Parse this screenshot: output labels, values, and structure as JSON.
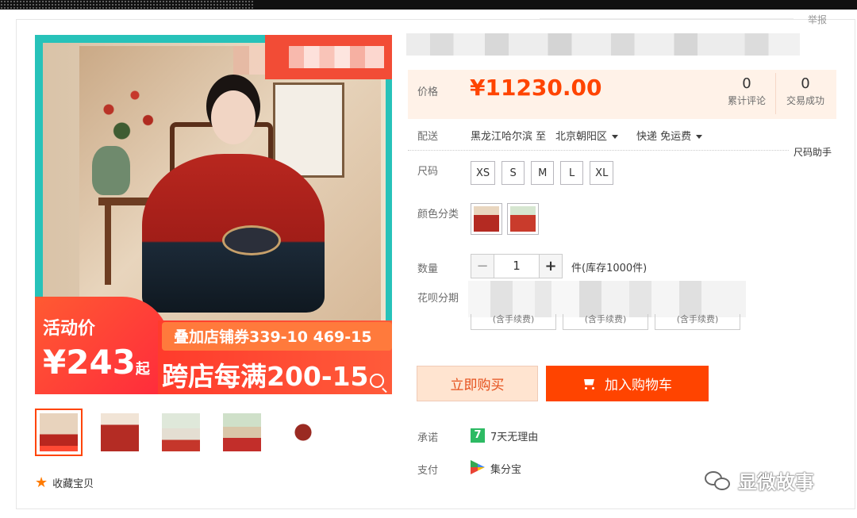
{
  "report_label": "举报",
  "gallery": {
    "promo_label": "活动价",
    "promo_price": "¥243",
    "promo_price_suffix": "起",
    "promo_line1": "叠加店铺券339-10 469-15",
    "promo_line2": "跨店每满200-15",
    "thumbnails": [
      "thumb-1",
      "thumb-2",
      "thumb-3",
      "thumb-4",
      "thumb-5"
    ],
    "active_thumb": 0,
    "favorite_label": "收藏宝贝"
  },
  "price_section": {
    "label": "价格",
    "price": "¥11230.00",
    "reviews_count": "0",
    "reviews_label": "累计评论",
    "deals_count": "0",
    "deals_label": "交易成功"
  },
  "shipping": {
    "label": "配送",
    "from_to": "黑龙江哈尔滨 至",
    "destination": "北京朝阳区",
    "method": "快递 免运费"
  },
  "size": {
    "label": "尺码",
    "helper": "尺码助手",
    "options": [
      "XS",
      "S",
      "M",
      "L",
      "XL"
    ]
  },
  "color": {
    "label": "颜色分类",
    "options": [
      "color-1",
      "color-2"
    ]
  },
  "quantity": {
    "label": "数量",
    "value": "1",
    "minus": "−",
    "plus": "+",
    "stock": "件(库存1000件)"
  },
  "huabei": {
    "label": "花呗分期",
    "options": [
      "(含手续费)",
      "(含手续费)",
      "(含手续费)"
    ]
  },
  "actions": {
    "buy_now": "立即购买",
    "add_to_cart": "加入购物车"
  },
  "promise": {
    "label": "承诺",
    "badge": "7",
    "text": "7天无理由"
  },
  "payment": {
    "label": "支付",
    "text": "集分宝"
  },
  "watermark": "显微故事",
  "colors": {
    "accent": "#ff4400",
    "price": "#ff4400",
    "price_bg": "#fff2e8"
  }
}
